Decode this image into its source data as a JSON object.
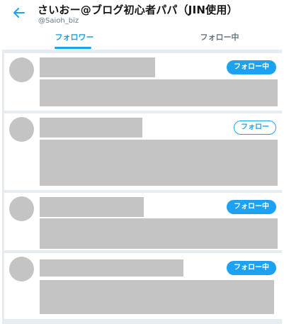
{
  "header": {
    "title": "さいおー@ブログ初心者パパ（JIN使用）",
    "handle": "@Saioh_biz",
    "back_icon": "arrow-left-icon"
  },
  "tabs": [
    {
      "label": "フォロワー",
      "active": true
    },
    {
      "label": "フォロー中",
      "active": false
    }
  ],
  "colors": {
    "accent": "#1da1f2",
    "placeholder": "#c4c4c4",
    "divider": "#e6ecf0"
  },
  "users": [
    {
      "button_label": "フォロー中",
      "is_following": true
    },
    {
      "button_label": "フォロー",
      "is_following": false
    },
    {
      "button_label": "フォロー中",
      "is_following": true
    },
    {
      "button_label": "フォロー中",
      "is_following": true
    }
  ]
}
